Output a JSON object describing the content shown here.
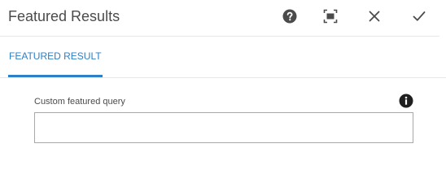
{
  "dialog": {
    "title": "Featured Results",
    "header_icons": {
      "help": "help-circle-icon",
      "fullscreen": "fullscreen-icon",
      "close": "close-icon",
      "done": "checkmark-icon"
    }
  },
  "tabs": [
    {
      "label": "FEATURED RESULT",
      "active": true
    }
  ],
  "form": {
    "custom_query": {
      "label": "Custom featured query",
      "value": "",
      "placeholder": "",
      "info_icon": "info-icon"
    }
  },
  "colors": {
    "accent": "#2d80c6",
    "icon": "#4b4b4b",
    "divider": "#e8e8e8",
    "input_border": "#a8a8a8"
  }
}
